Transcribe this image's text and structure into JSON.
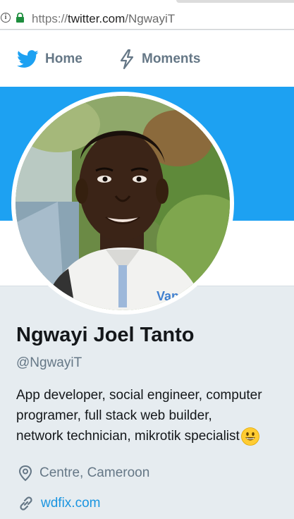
{
  "browser": {
    "url_scheme": "https://",
    "url_host": "twitter.com",
    "url_path": "/NgwayiT"
  },
  "nav": {
    "home_label": "Home",
    "moments_label": "Moments"
  },
  "profile": {
    "name": "Ngwayi Joel Tanto",
    "handle": "@NgwayiT",
    "bio_lines": [
      "App developer, social engineer, computer",
      "programer, full stack web builder,",
      "network technician, mikrotik specialist"
    ],
    "location": "Centre, Cameroon",
    "website": "wdfix.com"
  },
  "colors": {
    "banner": "#1da1f2",
    "link": "#1b95e0",
    "muted": "#657786",
    "text": "#14171a",
    "page_bg": "#e6ecf0"
  },
  "icons": {
    "bird": "twitter-bird-icon",
    "moments": "lightning-bolt-icon",
    "location": "map-pin-icon",
    "link": "chain-link-icon",
    "emoji": "grinning-face-emoji"
  }
}
